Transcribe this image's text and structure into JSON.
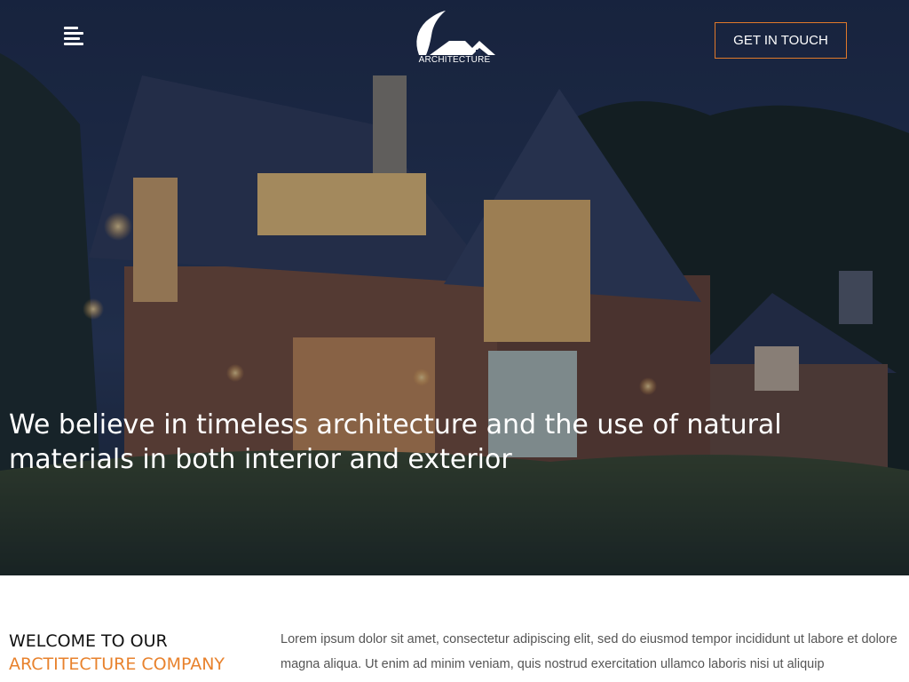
{
  "header": {
    "menu_icon": "hamburger-menu-icon",
    "logo_text": "ARCHITECTURE",
    "cta_label": "GET IN TOUCH",
    "accent_color": "#e0792a"
  },
  "hero": {
    "headline": "We believe in timeless architecture and the use of natural materials in both interior and exterior"
  },
  "about": {
    "title_line1": "WELCOME TO OUR",
    "title_accent": "ARCTITECTURE COMPANY",
    "body": "Lorem ipsum dolor sit amet, consectetur adipiscing elit, sed do eiusmod tempor incididunt ut labore et dolore magna aliqua. Ut enim ad minim veniam, quis nostrud exercitation ullamco laboris nisi ut aliquip"
  }
}
